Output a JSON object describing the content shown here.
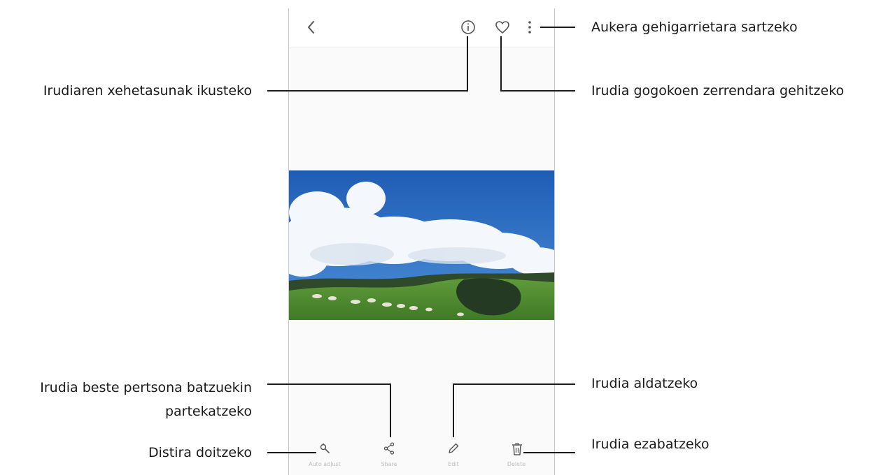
{
  "callouts": {
    "more_options": "Aukera gehigarrietara sartzeko",
    "details": "Irudiaren xehetasunak ikusteko",
    "favorite": "Irudia gogokoen zerrendara gehitzeko",
    "share_line1": "Irudia beste pertsona batzuekin",
    "share_line2": "partekatzeko",
    "edit": "Irudia aldatzeko",
    "brightness": "Distira doitzeko",
    "delete": "Irudia ezabatzeko"
  },
  "bottom_bar": {
    "brightness_label": "Auto adjust",
    "share_label": "Share",
    "edit_label": "Edit",
    "delete_label": "Delete"
  },
  "icons": {
    "back": "chevron-left-icon",
    "details": "info-icon",
    "favorite": "heart-icon",
    "more": "more-vertical-icon",
    "brightness": "magic-wand-icon",
    "share": "share-icon",
    "edit": "pencil-icon",
    "delete": "trash-icon"
  },
  "colors": {
    "callout_line": "#1a1a1a",
    "icon": "#555555",
    "sky": "#2d6fc4"
  }
}
